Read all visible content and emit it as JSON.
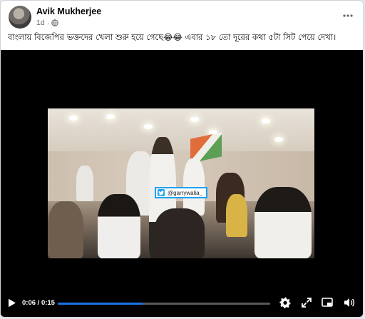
{
  "post": {
    "author": "Avik Mukherjee",
    "time_ago": "1d",
    "privacy_icon": "globe-icon",
    "caption": "বাংলায় বিজেপির ভক্তদের খেলা শুরু হয়ে গেছে😂😂 এবার ১৮ তো দূরের কথা ৫টা সিট পেয়ে দেখা।"
  },
  "video": {
    "watermark_handle": "@garrywalia_",
    "current_time": "0:06",
    "duration": "0:15",
    "time_separator": " / ",
    "progress_fraction": 0.4,
    "accent_color": "#1b74e4",
    "controls": [
      "play-icon",
      "settings-icon",
      "fullscreen-expand-icon",
      "picture-in-picture-icon",
      "volume-icon"
    ]
  }
}
